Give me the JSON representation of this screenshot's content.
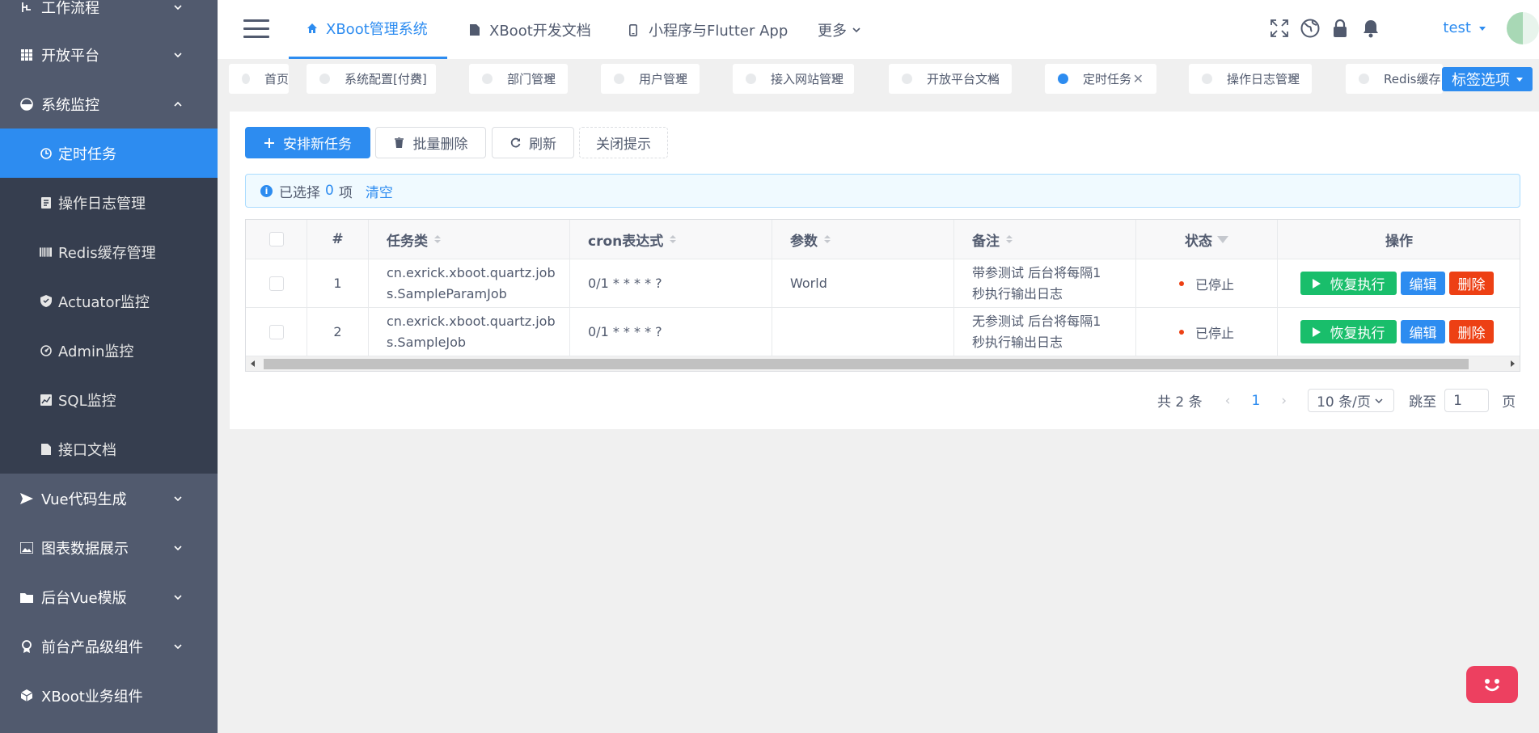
{
  "sidebar": {
    "menus": [
      {
        "label": "工作流程",
        "icon": "workflow-icon",
        "expanded": false
      },
      {
        "label": "开放平台",
        "icon": "grid-icon",
        "expanded": false
      },
      {
        "label": "系统监控",
        "icon": "monitor-icon",
        "expanded": true
      }
    ],
    "submenu": [
      {
        "label": "定时任务",
        "icon": "clock-icon",
        "active": true
      },
      {
        "label": "操作日志管理",
        "icon": "log-icon",
        "active": false
      },
      {
        "label": "Redis缓存管理",
        "icon": "barcode-icon",
        "active": false
      },
      {
        "label": "Actuator监控",
        "icon": "shield-icon",
        "active": false
      },
      {
        "label": "Admin监控",
        "icon": "gauge-icon",
        "active": false
      },
      {
        "label": "SQL监控",
        "icon": "chart-icon",
        "active": false
      },
      {
        "label": "接口文档",
        "icon": "document-icon",
        "active": false
      }
    ],
    "bottom_menus": [
      {
        "label": "Vue代码生成",
        "icon": "send-icon"
      },
      {
        "label": "图表数据展示",
        "icon": "image-icon"
      },
      {
        "label": "后台Vue模版",
        "icon": "folder-icon"
      },
      {
        "label": "前台产品级组件",
        "icon": "ribbon-icon"
      },
      {
        "label": "XBoot业务组件",
        "icon": "cube-icon"
      }
    ]
  },
  "header": {
    "nav": [
      {
        "label": "XBoot管理系统",
        "icon": "home-icon",
        "active": true
      },
      {
        "label": "XBoot开发文档",
        "icon": "document-icon",
        "active": false
      },
      {
        "label": "小程序与Flutter App",
        "icon": "phone-icon",
        "active": false
      },
      {
        "label": "更多",
        "icon": "",
        "active": false
      }
    ],
    "user": "test"
  },
  "tags": {
    "items": [
      {
        "label": "首页",
        "closable": false,
        "active": false
      },
      {
        "label": "系统配置[付费]",
        "closable": true,
        "active": false
      },
      {
        "label": "部门管理",
        "closable": true,
        "active": false
      },
      {
        "label": "用户管理",
        "closable": true,
        "active": false
      },
      {
        "label": "接入网站管理",
        "closable": true,
        "active": false
      },
      {
        "label": "开放平台文档",
        "closable": true,
        "active": false
      },
      {
        "label": "定时任务",
        "closable": true,
        "active": true
      },
      {
        "label": "操作日志管理",
        "closable": true,
        "active": false
      },
      {
        "label": "Redis缓存",
        "closable": false,
        "active": false
      }
    ],
    "options_label": "标签选项",
    "close_glyph": "✕"
  },
  "toolbar": {
    "add_label": "安排新任务",
    "delete_label": "批量删除",
    "refresh_label": "刷新",
    "close_tip_label": "关闭提示"
  },
  "alert": {
    "prefix": "已选择",
    "count": "0",
    "suffix": "项",
    "clear": "清空"
  },
  "table": {
    "columns": [
      "#",
      "任务类",
      "cron表达式",
      "参数",
      "备注",
      "状态",
      "操作"
    ],
    "rows": [
      {
        "index": "1",
        "class_line1": "cn.exrick.xboot.quartz.job",
        "class_line2": "s.SampleParamJob",
        "cron": "0/1 * * * * ?",
        "param": "World",
        "note_line1": "带参测试 后台将每隔1",
        "note_line2": "秒执行输出日志",
        "status": "已停止"
      },
      {
        "index": "2",
        "class_line1": "cn.exrick.xboot.quartz.job",
        "class_line2": "s.SampleJob",
        "cron": "0/1 * * * * ?",
        "param": "",
        "note_line1": "无参测试 后台将每隔1",
        "note_line2": "秒执行输出日志",
        "status": "已停止"
      }
    ],
    "actions": {
      "resume": "恢复执行",
      "edit": "编辑",
      "delete": "删除"
    }
  },
  "pagination": {
    "total": "共 2 条",
    "current_page": "1",
    "page_size": "10 条/页",
    "jump_label": "跳至",
    "jump_value": "1",
    "page_suffix": "页"
  },
  "colors": {
    "primary": "#2d8cf0",
    "success": "#19be6b",
    "error": "#ed4014",
    "sidebar_bg": "#515a6e",
    "submenu_bg": "#363e4f"
  }
}
